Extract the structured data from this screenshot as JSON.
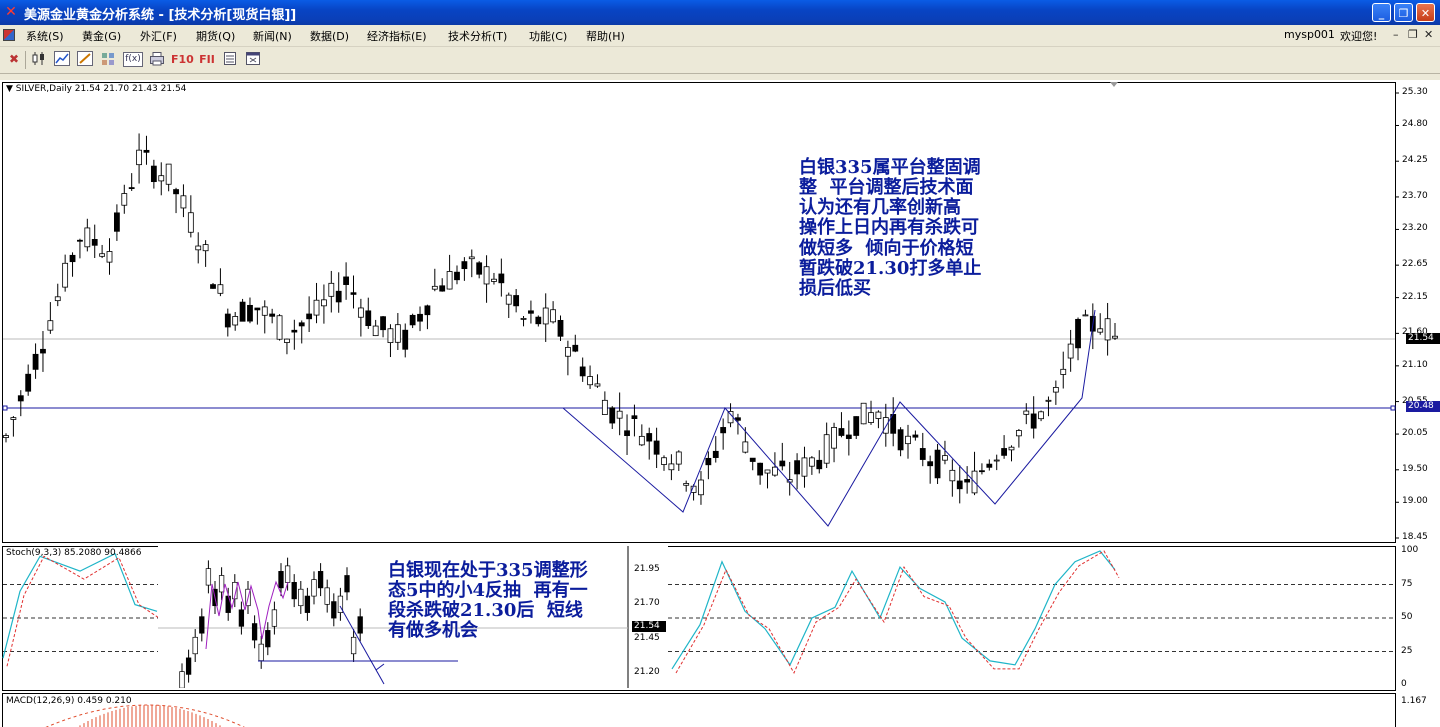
{
  "window": {
    "title": "美源金业黄金分析系统 - [技术分析[现货白银]]"
  },
  "menu": {
    "items": [
      "系统(S)",
      "黄金(G)",
      "外汇(F)",
      "期货(Q)",
      "新闻(N)",
      "数据(D)",
      "经济指标(E)",
      "技术分析(T)",
      "功能(C)",
      "帮助(H)"
    ],
    "user": "mysp001",
    "welcome": "欢迎您!"
  },
  "toolbar": {
    "icons": [
      "close-chart-icon",
      "candlestick-icon",
      "line-chart-icon",
      "draw-icon",
      "grid-icon",
      "fx-icon",
      "print-icon",
      "f10-label",
      "f11-label",
      "list-icon",
      "calendar-icon"
    ],
    "f10": "F10",
    "f11": "FII",
    "fx": "f(x)"
  },
  "chart": {
    "symbol_header": "▼ SILVER,Daily  21.54 21.70 21.43 21.54",
    "current_price": "21.54",
    "level_price": "20.48",
    "price_ticks": [
      "25.30",
      "24.80",
      "24.25",
      "23.70",
      "23.20",
      "22.65",
      "22.15",
      "21.60",
      "21.10",
      "20.55",
      "20.05",
      "19.50",
      "19.00",
      "18.45"
    ],
    "colors": {
      "line": "#1a1aa0",
      "bull": "#ffffff",
      "bear": "#000000",
      "stoch_main": "#1fb5c8",
      "stoch_signal": "#e03030"
    }
  },
  "stoch": {
    "label": "Stoch(9,3,3) 85.2080 90.4866",
    "ticks": [
      "100",
      "75",
      "50",
      "25",
      "0"
    ]
  },
  "macd": {
    "label": "MACD(12,26,9) 0.459 0.210",
    "tick": "1.167"
  },
  "inset": {
    "ticks": [
      "21.95",
      "21.70",
      "21.45",
      "21.20"
    ],
    "price": "21.54"
  },
  "annotations": {
    "main": "白银335属平台整固调\n整  平台调整后技术面\n认为还有几率创新高\n操作上日内再有杀跌可\n做短多  倾向于价格短\n暂跌破21.30打多单止\n损后低买",
    "inset": "白银现在处于335调整形\n态5中的小4反抽  再有一\n段杀跌破21.30后  短线\n有做多机会"
  }
}
